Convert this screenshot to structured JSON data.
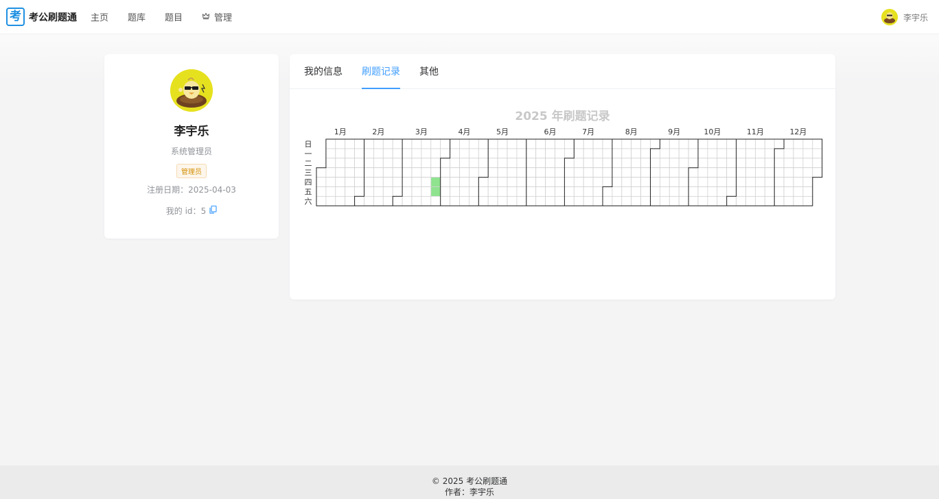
{
  "app": {
    "logo_mark": "考",
    "name": "考公刷题通"
  },
  "nav": {
    "items": [
      {
        "label": "主页"
      },
      {
        "label": "题库"
      },
      {
        "label": "题目"
      },
      {
        "label": "管理",
        "icon": "gear-icon"
      }
    ]
  },
  "user": {
    "name": "李宇乐"
  },
  "profile": {
    "name": "李宇乐",
    "role": "系统管理员",
    "badge": "管理员",
    "registered_label": "注册日期：",
    "registered_date": "2025-04-03",
    "id_label": "我的 id：",
    "id_value": "5"
  },
  "tabs": [
    {
      "label": "我的信息",
      "active": false
    },
    {
      "label": "刷题记录",
      "active": true
    },
    {
      "label": "其他",
      "active": false
    }
  ],
  "heatmap": {
    "title": "2025 年刷题记录",
    "year": 2025,
    "weekday_labels": [
      "日",
      "一",
      "二",
      "三",
      "四",
      "五",
      "六"
    ],
    "month_labels": [
      "1月",
      "2月",
      "3月",
      "4月",
      "5月",
      "6月",
      "7月",
      "8月",
      "9月",
      "10月",
      "11月",
      "12月"
    ],
    "active_dates": [
      {
        "date": "2025-03-27",
        "count": 1
      },
      {
        "date": "2025-03-28",
        "count": 1
      }
    ],
    "colors": {
      "active": "#8fe38f",
      "empty": "#ffffff",
      "grid": "#d0d0d0",
      "month_border": "#222222"
    }
  },
  "footer": {
    "copyright": "© 2025 考公刷题通",
    "author": "作者：李宇乐"
  }
}
